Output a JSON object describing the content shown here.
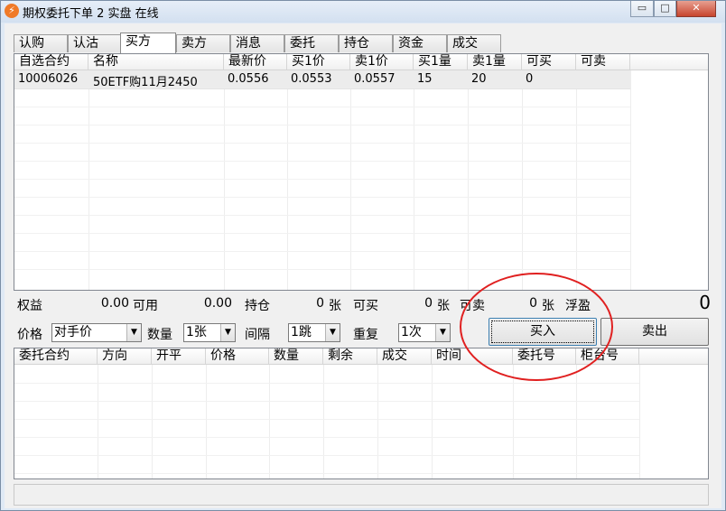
{
  "window": {
    "title": "期权委托下单 2 实盘 在线",
    "app_icon_glyph": "⚡",
    "minimize_glyph": "▭",
    "maximize_glyph": "□",
    "close_glyph": "✕"
  },
  "tabs": [
    {
      "label": "认购"
    },
    {
      "label": "认沽"
    },
    {
      "label": "买方"
    },
    {
      "label": "卖方"
    },
    {
      "label": "消息"
    },
    {
      "label": "委托"
    },
    {
      "label": "持仓"
    },
    {
      "label": "资金"
    },
    {
      "label": "成交"
    }
  ],
  "active_tab": "买方",
  "quote_table": {
    "columns": [
      "自选合约",
      "名称",
      "最新价",
      "买1价",
      "卖1价",
      "买1量",
      "卖1量",
      "可买",
      "可卖"
    ],
    "rows": [
      {
        "code": "10006026",
        "name": "50ETF购11月2450",
        "last": "0.0556",
        "bid1": "0.0553",
        "ask1": "0.0557",
        "bid1_qty": "15",
        "ask1_qty": "20",
        "can_buy": "0",
        "can_sell": ""
      }
    ]
  },
  "summary": {
    "equity_label": "权益",
    "equity_value": "0.00",
    "available_label": "可用",
    "available_value": "0.00",
    "position_label": "持仓",
    "position_value": "0",
    "position_unit": "张",
    "can_buy_label": "可买",
    "can_buy_value": "0",
    "can_buy_unit": "张",
    "can_sell_label": "可卖",
    "can_sell_value": "0",
    "can_sell_unit": "张",
    "float_pl_label": "浮盈",
    "float_pl_value": "0"
  },
  "order_form": {
    "price_label": "价格",
    "price_value": "对手价",
    "qty_label": "数量",
    "qty_value": "1张",
    "interval_label": "间隔",
    "interval_value": "1跳",
    "repeat_label": "重复",
    "repeat_value": "1次",
    "buy_label": "买入",
    "sell_label": "卖出"
  },
  "orders_table": {
    "columns": [
      "委托合约",
      "方向",
      "开平",
      "价格",
      "数量",
      "剩余",
      "成交",
      "时间",
      "委托号",
      "柜台号"
    ],
    "rows": []
  },
  "colors": {
    "highlight_circle": "#e02020"
  }
}
